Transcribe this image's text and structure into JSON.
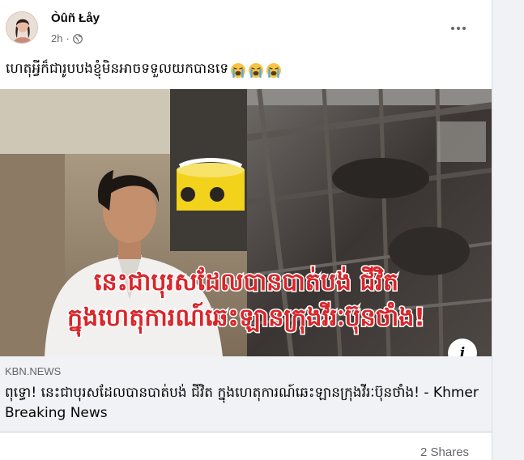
{
  "post": {
    "author": "Òûñ Łåy",
    "time": "2h",
    "separator": "·",
    "privacy_icon": "globe-icon",
    "menu_icon": "more-horizontal-icon",
    "text": "ហេតុអ្វីក៏ជារូបបងខ្ញុំមិនអាចទទួលយកបានទេ",
    "emojis": [
      "crying-face",
      "crying-face",
      "crying-face"
    ]
  },
  "image": {
    "overlay_line1": "នេះជាបុរសដែលបានបាត់បង់ ជីវិត",
    "overlay_line2": "ក្នុងហេតុការណ៍ឆេះឡានក្រុងវីរៈប៊ុនថាំង!",
    "info_label": "i"
  },
  "link": {
    "domain": "KBN.NEWS",
    "title": "ពុទ្ធោ! នេះជាបុរសដែលបានបាត់បង់ ជីវិត ក្នុងហេតុការណ៍ឆេះឡានក្រុងវីរៈប៊ុនថាំង! - Khmer Breaking News"
  },
  "footer": {
    "shares": "2 Shares"
  },
  "colors": {
    "overlay_text": "#d8262b",
    "overlay_outline": "#ffffff",
    "secondary_text": "#65676b",
    "link_bg": "#f0f2f5"
  }
}
